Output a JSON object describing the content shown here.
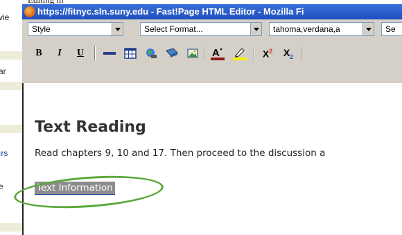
{
  "background_window": {
    "fragments": [
      "vie",
      "ar",
      "ırs",
      "e"
    ],
    "top_fragment": "Editing in"
  },
  "editor_window": {
    "title": "https://fitnyc.sln.suny.edu - Fast!Page HTML Editor - Mozilla Fi",
    "toolbar": {
      "style_select": "Style",
      "format_select": "Select Format...",
      "font_select": "tahoma,verdana,a",
      "size_select": "Se",
      "buttons": {
        "bold": "B",
        "italic": "I",
        "underline": "U",
        "superscript": "X",
        "subscript": "X"
      }
    },
    "content": {
      "heading": "Text Reading",
      "body": "Read chapters 9, 10 and 17. Then proceed to the discussion a",
      "selected_link": "Text Information"
    }
  },
  "colors": {
    "title_bar": "#2356c8",
    "toolbar": "#d4d0c8",
    "selection": "#8c8c8c",
    "annotation": "#58a83a"
  }
}
